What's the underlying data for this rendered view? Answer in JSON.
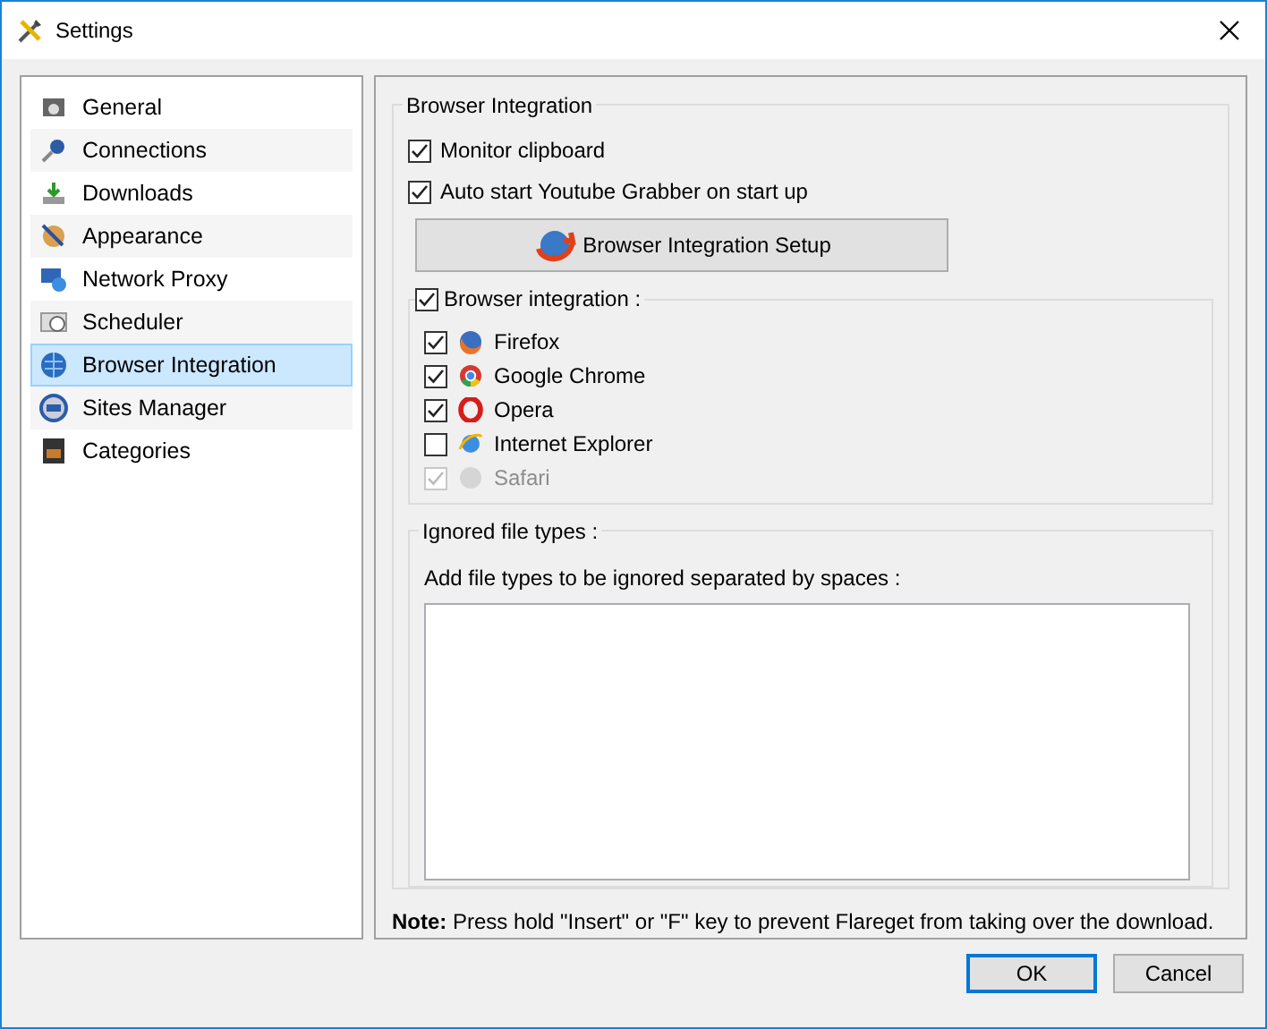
{
  "window": {
    "title": "Settings"
  },
  "sidebar": {
    "items": [
      {
        "label": "General",
        "selected": false
      },
      {
        "label": "Connections",
        "selected": false
      },
      {
        "label": "Downloads",
        "selected": false
      },
      {
        "label": "Appearance",
        "selected": false
      },
      {
        "label": "Network Proxy",
        "selected": false
      },
      {
        "label": "Scheduler",
        "selected": false
      },
      {
        "label": "Browser Integration",
        "selected": true
      },
      {
        "label": "Sites Manager",
        "selected": false
      },
      {
        "label": "Categories",
        "selected": false
      }
    ]
  },
  "group": {
    "title": "Browser Integration",
    "options": [
      {
        "label": "Monitor clipboard",
        "checked": true
      },
      {
        "label": "Auto start Youtube Grabber on start up",
        "checked": true
      }
    ],
    "setup_button": "Browser Integration Setup",
    "browsers": {
      "label": "Browser integration :",
      "checked": true,
      "items": [
        {
          "label": "Firefox",
          "checked": true,
          "disabled": false
        },
        {
          "label": "Google Chrome",
          "checked": true,
          "disabled": false
        },
        {
          "label": "Opera",
          "checked": true,
          "disabled": false
        },
        {
          "label": "Internet Explorer",
          "checked": false,
          "disabled": false
        },
        {
          "label": "Safari",
          "checked": true,
          "disabled": true
        }
      ]
    },
    "ignored": {
      "title": "Ignored file types :",
      "label": "Add file types to be ignored separated by spaces :"
    }
  },
  "note": "**Note:** Press hold \"Insert\" or \"F\" key to prevent Flareget from taking over the download.",
  "buttons": [
    {
      "label": "OK",
      "selected": true
    },
    {
      "label": "Cancel",
      "selected": false
    }
  ]
}
